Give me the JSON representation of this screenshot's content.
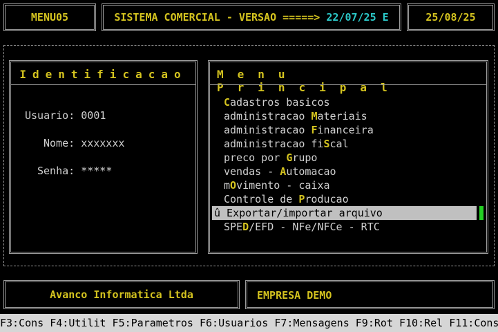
{
  "header": {
    "menu_id": "MENU05",
    "system_title": "SISTEMA COMERCIAL - VERSAO =====>",
    "version": "22/07/25 E",
    "date": "25/08/25"
  },
  "identification": {
    "title": "Identificacao",
    "user_label": "Usuario:",
    "user_value": "0001",
    "name_label": "Nome:",
    "name_value": "xxxxxxx",
    "password_label": "Senha:",
    "password_value": "*****"
  },
  "menu": {
    "title": "Menu Principal",
    "items": [
      {
        "pre": "",
        "key": "C",
        "post": "adastros basicos"
      },
      {
        "pre": "administracao ",
        "key": "M",
        "post": "ateriais"
      },
      {
        "pre": "administracao ",
        "key": "F",
        "post": "inanceira"
      },
      {
        "pre": "administracao fi",
        "key": "S",
        "post": "cal"
      },
      {
        "pre": "preco por ",
        "key": "G",
        "post": "rupo"
      },
      {
        "pre": "vendas - ",
        "key": "A",
        "post": "utomacao"
      },
      {
        "pre": "m",
        "key": "O",
        "post": "vimento - caixa"
      },
      {
        "pre": "Controle de ",
        "key": "P",
        "post": "roducao"
      },
      {
        "pre": "û Exportar/importar arquivo",
        "key": "",
        "post": ""
      },
      {
        "pre": "SPE",
        "key": "D",
        "post": "/EFD - NFe/NFCe - RTC"
      }
    ]
  },
  "footer": {
    "company": "Avanco Informatica Ltda",
    "empresa": "EMPRESA DEMO",
    "function_keys": "F3:Cons F4:Utilit F5:Parametros F6:Usuarios F7:Mensagens F9:Rot F10:Rel F11:Cons"
  },
  "colors": {
    "background": "#000000",
    "highlight": "#d4c31f",
    "cyan": "#2bc8c8",
    "selection": "#c0c0c0",
    "cursor": "#23d123"
  }
}
